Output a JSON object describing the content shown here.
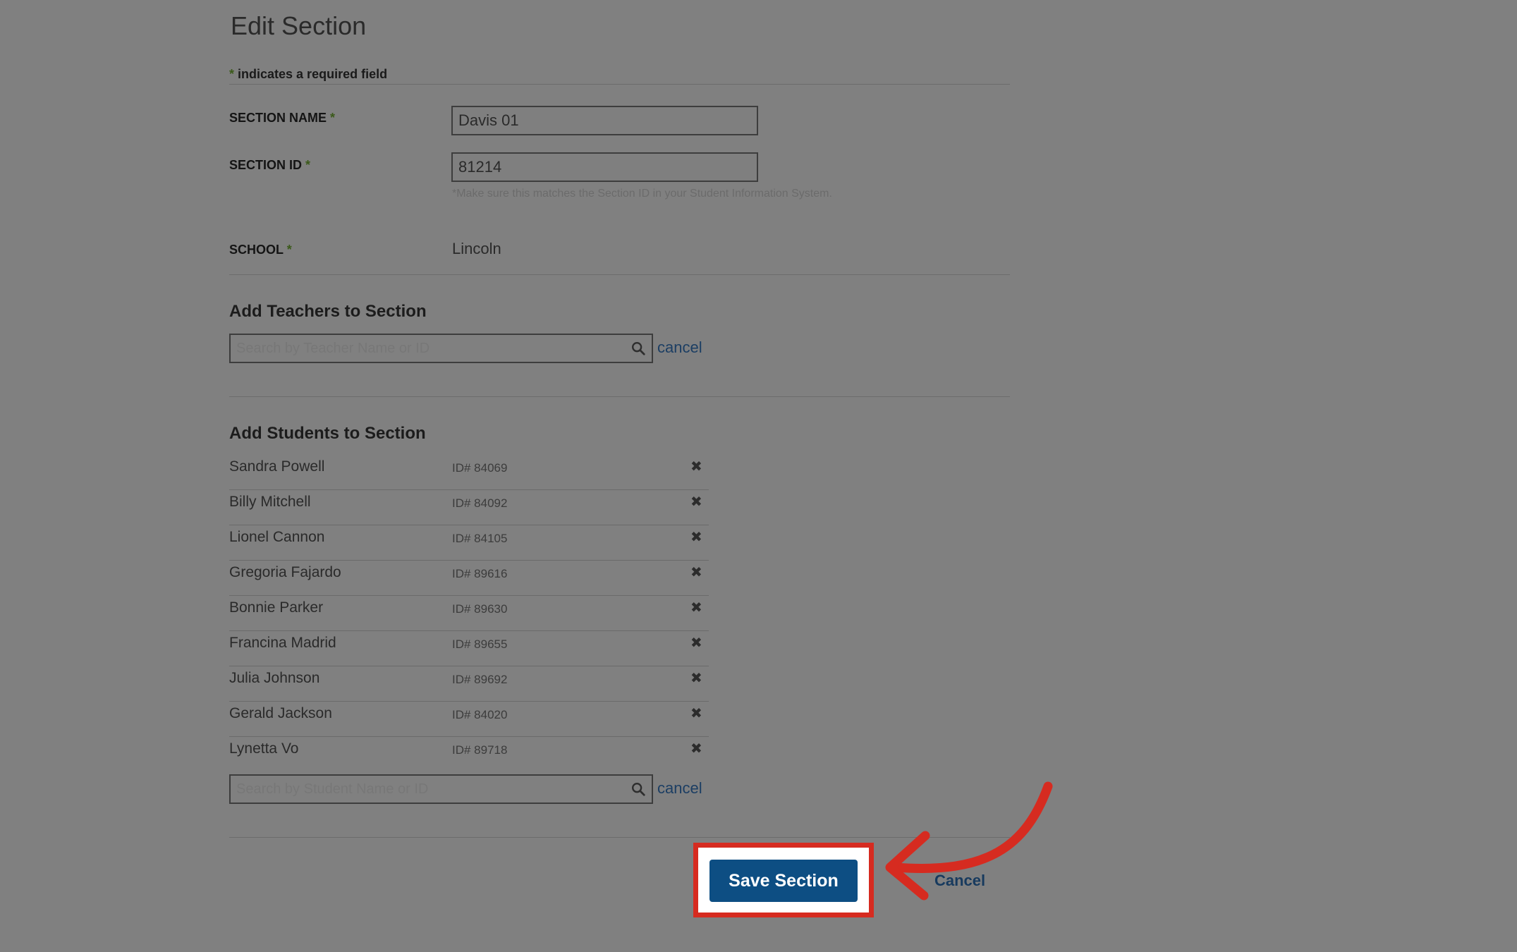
{
  "page": {
    "title": "Edit Section",
    "required_note": {
      "asterisk": "*",
      "text": " indicates a required field"
    }
  },
  "form": {
    "section_name": {
      "label": "SECTION NAME",
      "asterisk": "*",
      "value": "Davis 01"
    },
    "section_id": {
      "label": "SECTION ID",
      "asterisk": "*",
      "value": "81214",
      "hint": "*Make sure this matches the Section ID in your Student Information System."
    },
    "school": {
      "label": "SCHOOL",
      "asterisk": "*",
      "value": "Lincoln"
    }
  },
  "teachers": {
    "heading": "Add Teachers to Section",
    "search_placeholder": "Search by Teacher Name or ID",
    "cancel_label": "cancel",
    "search_icon": "search-icon"
  },
  "students": {
    "heading": "Add Students to Section",
    "remove_symbol": "✖",
    "items": [
      {
        "name": "Sandra Powell",
        "id": "ID# 84069"
      },
      {
        "name": "Billy Mitchell",
        "id": "ID# 84092"
      },
      {
        "name": "Lionel Cannon",
        "id": "ID# 84105"
      },
      {
        "name": "Gregoria Fajardo",
        "id": "ID# 89616"
      },
      {
        "name": "Bonnie Parker",
        "id": "ID# 89630"
      },
      {
        "name": "Francina Madrid",
        "id": "ID# 89655"
      },
      {
        "name": "Julia Johnson",
        "id": "ID# 89692"
      },
      {
        "name": "Gerald Jackson",
        "id": "ID# 84020"
      },
      {
        "name": "Lynetta Vo",
        "id": "ID# 89718"
      }
    ],
    "search_placeholder": "Search by Student Name or ID",
    "cancel_label": "cancel",
    "search_icon": "search-icon"
  },
  "actions": {
    "save_label": "Save Section",
    "cancel_label": "Cancel"
  },
  "annotation": {
    "highlight_color": "#d62b20",
    "arrow_color": "#d62b20"
  },
  "colors": {
    "overlay_background": "#808080",
    "primary_button": "#0d4e83",
    "link": "#1c3e63"
  }
}
